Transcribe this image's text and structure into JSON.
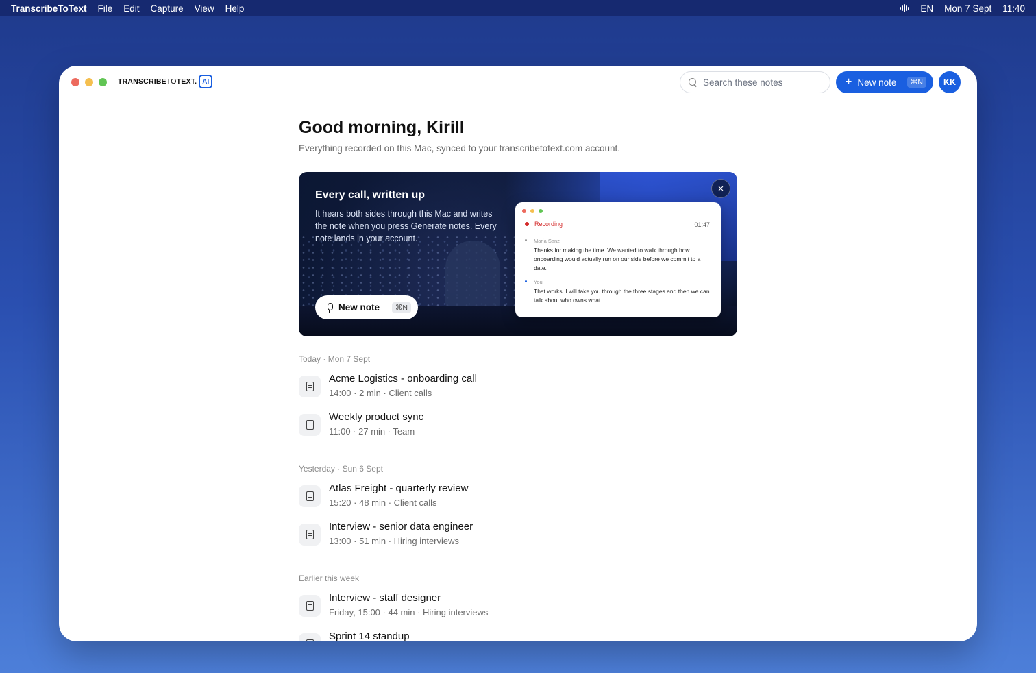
{
  "menubar": {
    "app_name": "TranscribeToText",
    "menus": [
      "File",
      "Edit",
      "Capture",
      "View",
      "Help"
    ],
    "input_language": "EN",
    "date": "Mon 7 Sept",
    "time": "11:40",
    "icons": [
      "audio-waveform-icon"
    ]
  },
  "window": {
    "brand": {
      "bold": "TRANSCRIBE",
      "light": "TO",
      "bold2": "TEXT.",
      "badge": "AI"
    },
    "search": {
      "placeholder": "Search these notes"
    },
    "new_note": {
      "label": "New note",
      "shortcut": "⌘N"
    },
    "avatar": "KK",
    "accent_color": "#1a5fe0"
  },
  "main": {
    "greeting": "Good morning, Kirill",
    "subtitle": "Everything recorded on this Mac, synced to your transcribetotext.com account.",
    "hero": {
      "title": "Every call, written up",
      "description": "It hears both sides through this Mac and writes the note when you press Generate notes. Every note lands in your account.",
      "button_label": "New note",
      "button_shortcut": "⌘N",
      "close_label": "×",
      "recording": {
        "status": "Recording",
        "elapsed": "01:47",
        "turns": [
          {
            "speaker": "Maria Sanz",
            "text": "Thanks for making the time. We wanted to walk through how onboarding would actually run on our side before we commit to a date."
          },
          {
            "speaker": "You",
            "text": "That works. I will take you through the three stages and then we can talk about who owns what."
          }
        ]
      }
    },
    "sections": [
      {
        "label": "Today",
        "date": "Mon 7 Sept",
        "notes": [
          {
            "title": "Acme Logistics - onboarding call",
            "meta": "14:00 · 2 min · Client calls"
          },
          {
            "title": "Weekly product sync",
            "meta": "11:00 · 27 min · Team"
          }
        ]
      },
      {
        "label": "Yesterday",
        "date": "Sun 6 Sept",
        "notes": [
          {
            "title": "Atlas Freight - quarterly review",
            "meta": "15:20 · 48 min · Client calls"
          },
          {
            "title": "Interview - senior data engineer",
            "meta": "13:00 · 51 min · Hiring interviews"
          }
        ]
      },
      {
        "label": "Earlier this week",
        "date": "",
        "notes": [
          {
            "title": "Interview - staff designer",
            "meta": "Friday, 15:00 · 44 min · Hiring interviews"
          },
          {
            "title": "Sprint 14 standup",
            "meta": ""
          }
        ]
      }
    ]
  }
}
